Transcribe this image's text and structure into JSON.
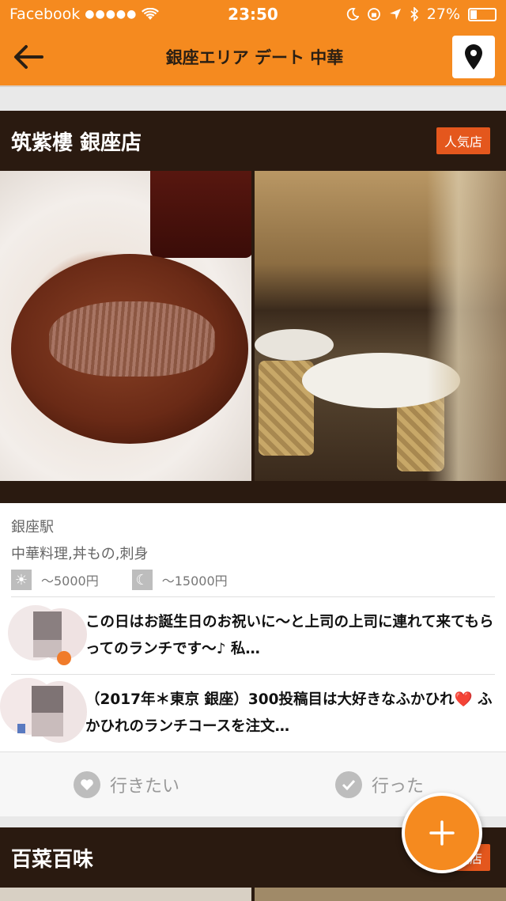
{
  "status_bar": {
    "carrier": "Facebook",
    "signal": "●●●●●",
    "time": "23:50",
    "battery": "27%",
    "battery_level": 0.27
  },
  "nav": {
    "title": "銀座エリア デート 中華"
  },
  "restaurant": {
    "name": "筑紫樓 銀座店",
    "badge": "人気店",
    "station": "銀座駅",
    "genres": "中華料理,丼もの,刺身",
    "lunch_price": "〜5000円",
    "dinner_price": "〜15000円",
    "reviews": [
      {
        "text": "この日はお誕生日のお祝いに〜と上司の上司に連れて来てもらってのランチです〜♪ 私…"
      },
      {
        "text": "（2017年＊東京 銀座）300投稿目は大好きなふかひれ❤️ ふかひれのランチコースを注文…"
      }
    ],
    "actions": {
      "want": "行きたい",
      "went": "行った"
    }
  },
  "next_restaurant": {
    "name": "百菜百味",
    "badge": "人気店"
  },
  "colors": {
    "accent": "#f58a1f",
    "header_bg": "#2a1a10",
    "badge": "#e4571d"
  }
}
